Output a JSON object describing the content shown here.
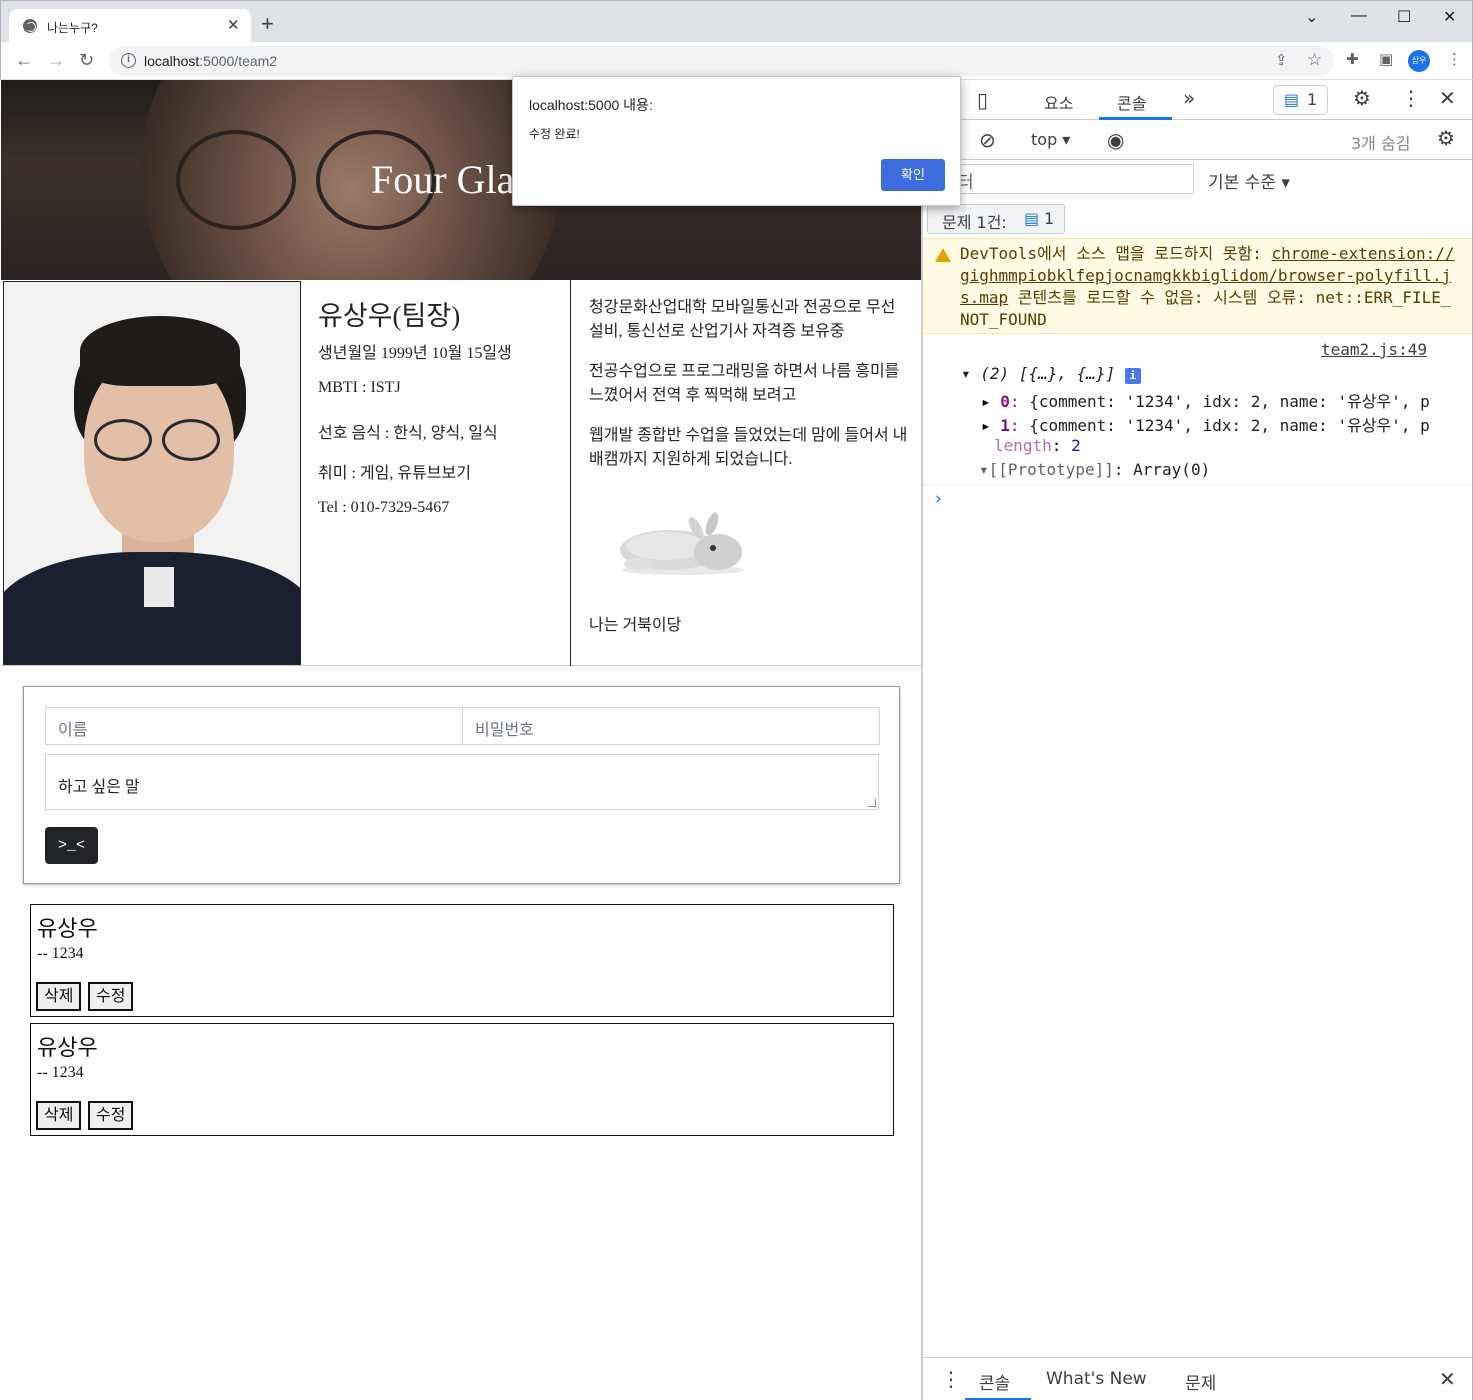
{
  "browser": {
    "tab_title": "나는누구?",
    "url_host": "localhost",
    "url_rest": ":5000/team2",
    "profile_initials": "상우",
    "window_controls": [
      "chevron-down-icon",
      "minimize-icon",
      "maximize-icon",
      "close-icon"
    ]
  },
  "alert": {
    "origin": "localhost:5000 내용:",
    "message": "수정 완료!",
    "ok_label": "확인"
  },
  "page": {
    "hero_title": "Four Gla",
    "profile": {
      "name": "유상우(팀장)",
      "birth": "생년월일 1999년 10월 15일생",
      "mbti": "MBTI : ISTJ",
      "food": "선호 음식 : 한식, 양식, 일식",
      "hobby": "취미 : 게임, 유튜브보기",
      "tel": "Tel : 010-7329-5467"
    },
    "intro": {
      "p1": "청강문화산업대학 모바일통신과 전공으로 무선설비, 통신선로 산업기사 자격증 보유중",
      "p2": "전공수업으로 프로그래밍을 하면서 나름 흥미를 느꼈어서 전역 후 찍먹해 보려고",
      "p3": "웹개발 종합반 수업을 들었었는데 맘에 들어서 내배캠까지 지원하게 되었습니다.",
      "caption": "나는 거북이당"
    },
    "form": {
      "name_placeholder": "이름",
      "password_placeholder": "비밀번호",
      "message_placeholder": "하고 싶은 말",
      "submit_label": ">_<"
    },
    "comments": [
      {
        "name": "유상우",
        "comment": "-- 1234",
        "delete_label": "삭제",
        "edit_label": "수정"
      },
      {
        "name": "유상우",
        "comment": "-- 1234",
        "delete_label": "삭제",
        "edit_label": "수정"
      }
    ]
  },
  "devtools": {
    "tabs": [
      "요소",
      "콘솔"
    ],
    "active_tab": "콘솔",
    "issues_badge_count": "1",
    "context": "top",
    "hidden_count": "3개 숨김",
    "filter_value": "터",
    "level": "기본 수준",
    "issues_label": "문제 1건:",
    "issues_count": "1",
    "warning": {
      "prefix": "DevTools에서 소스 맵을 로드하지 못함: ",
      "link": "chrome-extension://gighmmpiobklfepjocnamgkkbiglidom/browser-polyfill.js.map",
      "suffix": " 콘텐츠를 로드할 수 없음: 시스템 오류: net::ERR_FILE_NOT_FOUND"
    },
    "log_source": "team2.js:49",
    "log": {
      "summary": "(2) [{…}, {…}]",
      "item0_key": "0",
      "item1_key": "1",
      "item_preview": "{comment: '1234', idx: 2, name: '유상우', p",
      "length_key": "length",
      "length_value": "2",
      "prototype_key": "[[Prototype]]",
      "prototype_value": "Array(0)"
    },
    "drawer_tabs": [
      "콘솔",
      "What's New",
      "문제"
    ]
  },
  "colors": {
    "accent": "#1a73e8",
    "alert_button": "#3c6cde",
    "warning_bg": "#fffbe5",
    "string": "#c41a16"
  }
}
